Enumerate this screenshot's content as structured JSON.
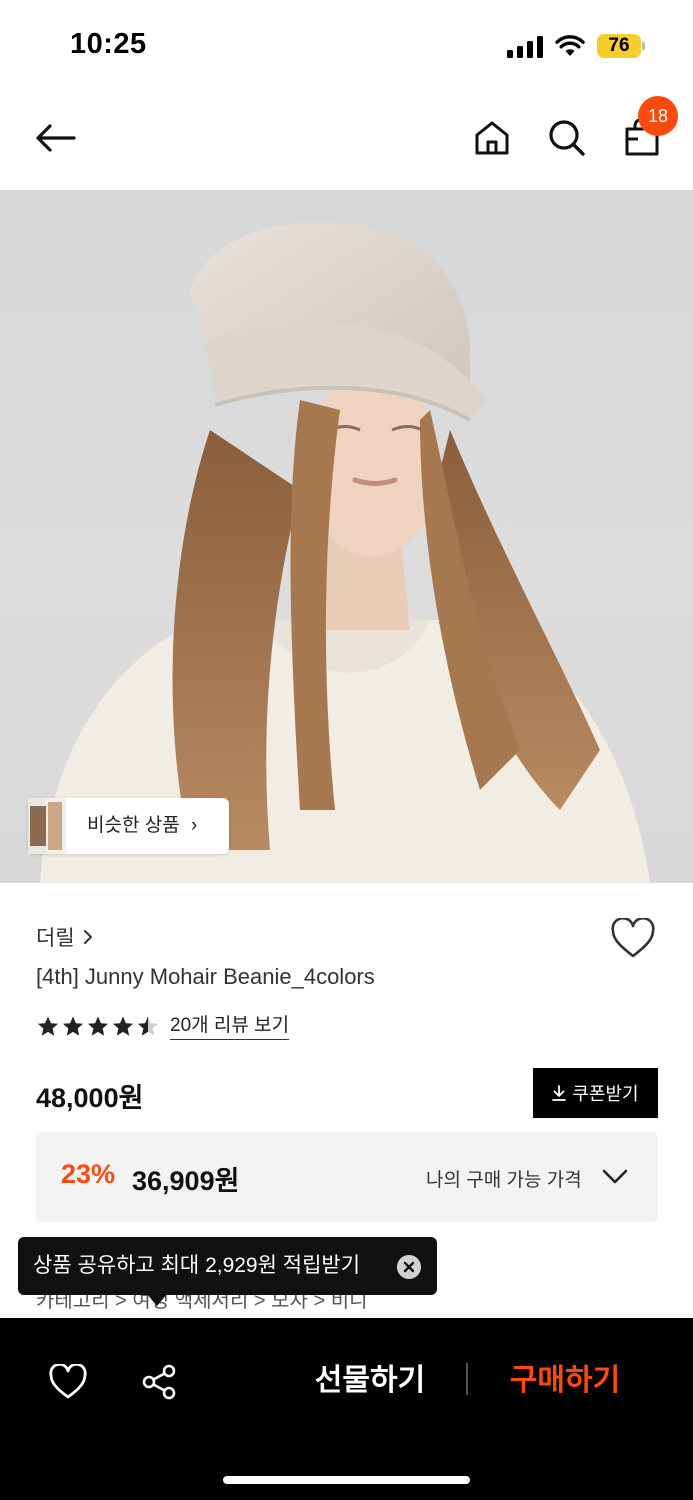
{
  "status": {
    "time": "10:25",
    "battery": "76"
  },
  "nav": {
    "cart_count": "18"
  },
  "hero": {
    "similar_label": "비슷한 상품"
  },
  "product": {
    "brand": "더릴",
    "title": "[4th] Junny Mohair Beanie_4colors",
    "rating": 4.5,
    "review_link": "20개 리뷰 보기",
    "price": "48,000원",
    "coupon_label": "쿠폰받기",
    "discount": "23%",
    "sale_price": "36,909원",
    "my_price_label": "나의 구매 가능 가격"
  },
  "breadcrumb": {
    "partial_text": "카테고리 > 여성 액세서리 > 모자 > 비니"
  },
  "tooltip": {
    "text": "상품 공유하고 최대 2,929원 적립받기"
  },
  "bottom_bar": {
    "gift_label": "선물하기",
    "buy_label": "구매하기"
  },
  "colors": {
    "accent": "#ff4a0e",
    "dark": "#000000"
  }
}
